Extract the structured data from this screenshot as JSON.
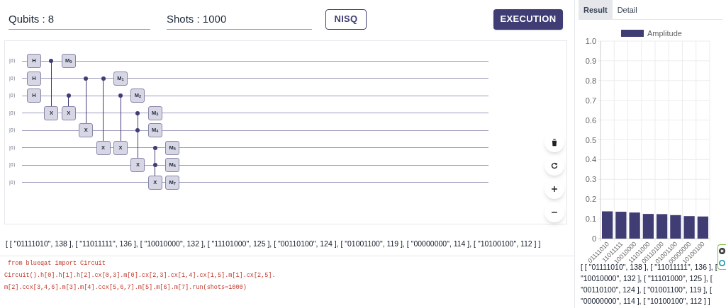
{
  "fields": [
    {
      "value": "Qubits : 8"
    },
    {
      "value": "Shots : 1000"
    }
  ],
  "nisq_button": "NISQ",
  "execution_button": "EXECUTION",
  "circuit": {
    "wires": [
      "|0⟩",
      "|0⟩",
      "|0⟩",
      "|0⟩",
      "|0⟩",
      "|0⟩",
      "|0⟩",
      "|0⟩"
    ],
    "steps": [
      [
        {
          "kind": "gate",
          "label": "H"
        },
        {
          "kind": "gate",
          "label": "H"
        },
        {
          "kind": "gate",
          "label": "H"
        },
        {
          "kind": "idle"
        },
        {
          "kind": "idle"
        },
        {
          "kind": "idle"
        },
        {
          "kind": "idle"
        },
        {
          "kind": "idle"
        }
      ],
      [
        {
          "kind": "control"
        },
        {
          "kind": "idle"
        },
        {
          "kind": "idle"
        },
        {
          "kind": "target",
          "label": "X"
        },
        {
          "kind": "idle"
        },
        {
          "kind": "idle"
        },
        {
          "kind": "idle"
        },
        {
          "kind": "idle"
        }
      ],
      [
        {
          "kind": "gate",
          "label": "M$_{0}$"
        },
        {
          "kind": "idle"
        },
        {
          "kind": "control"
        },
        {
          "kind": "target",
          "label": "X"
        },
        {
          "kind": "idle"
        },
        {
          "kind": "idle"
        },
        {
          "kind": "idle"
        },
        {
          "kind": "idle"
        }
      ],
      [
        {
          "kind": "idle"
        },
        {
          "kind": "control"
        },
        {
          "kind": "idle"
        },
        {
          "kind": "idle"
        },
        {
          "kind": "target",
          "label": "X"
        },
        {
          "kind": "idle"
        },
        {
          "kind": "idle"
        },
        {
          "kind": "idle"
        }
      ],
      [
        {
          "kind": "idle"
        },
        {
          "kind": "control"
        },
        {
          "kind": "idle"
        },
        {
          "kind": "idle"
        },
        {
          "kind": "idle"
        },
        {
          "kind": "target",
          "label": "X"
        },
        {
          "kind": "idle"
        },
        {
          "kind": "idle"
        }
      ],
      [
        {
          "kind": "idle"
        },
        {
          "kind": "gate",
          "label": "M$_{1}$"
        },
        {
          "kind": "control"
        },
        {
          "kind": "idle"
        },
        {
          "kind": "idle"
        },
        {
          "kind": "target",
          "label": "X"
        },
        {
          "kind": "idle"
        },
        {
          "kind": "idle"
        }
      ],
      [
        {
          "kind": "idle"
        },
        {
          "kind": "idle"
        },
        {
          "kind": "gate",
          "label": "M$_{2}$"
        },
        {
          "kind": "control"
        },
        {
          "kind": "control"
        },
        {
          "kind": "idle"
        },
        {
          "kind": "target",
          "label": "X"
        },
        {
          "kind": "idle"
        }
      ],
      [
        {
          "kind": "idle"
        },
        {
          "kind": "idle"
        },
        {
          "kind": "idle"
        },
        {
          "kind": "gate",
          "label": "M$_{3}$"
        },
        {
          "kind": "gate",
          "label": "M$_{4}$"
        },
        {
          "kind": "control"
        },
        {
          "kind": "control"
        },
        {
          "kind": "target",
          "label": "X"
        }
      ],
      [
        {
          "kind": "idle"
        },
        {
          "kind": "idle"
        },
        {
          "kind": "idle"
        },
        {
          "kind": "idle"
        },
        {
          "kind": "idle"
        },
        {
          "kind": "gate",
          "label": "M$_{5}$"
        },
        {
          "kind": "gate",
          "label": "M$_{6}$"
        },
        {
          "kind": "gate",
          "label": "M$_{7}$"
        }
      ]
    ]
  },
  "tool_buttons": [
    {
      "kind": "delete"
    },
    {
      "kind": "reset"
    },
    {
      "kind": "zoom-in"
    },
    {
      "kind": "zoom-out"
    }
  ],
  "result_text": "[ [ \"01111010\", 138 ], [ \"11011111\", 136 ], [ \"10010000\", 132 ], [ \"11101000\", 125 ], [ \"00110100\", 124 ], [ \"01001100\", 119 ], [ \"00000000\", 114 ], [ \"10100100\", 112 ] ]",
  "code_lines": [
    " from blueqat import Circuit",
    "Circuit().h[0].h[1].h[2].cx[0,3].m[0].cx[2,3].cx[1,4].cx[1,5].m[1].cx[2,5].",
    "m[2].ccx[3,4,6].m[3].m[4].ccx[5,6,7].m[5].m[6].m[7].run(shots=1000)"
  ],
  "tabs": [
    {
      "label": "Result",
      "selected": true
    },
    {
      "label": "Detail",
      "selected": false
    }
  ],
  "chart_data": {
    "type": "bar",
    "grid": true,
    "categories": [
      "01111010",
      "11011111",
      "10010000",
      "11101000",
      "00110100",
      "01001100",
      "00000000",
      "10100100"
    ],
    "series": [
      {
        "name": "Amplitude",
        "color": "#3f3d74",
        "values": [
          0.138,
          0.136,
          0.132,
          0.125,
          0.124,
          0.119,
          0.114,
          0.112
        ]
      }
    ],
    "ylim": [
      0,
      1
    ],
    "yticks": [
      {
        "value": 0,
        "label": "0"
      },
      {
        "value": 0.1,
        "label": "0.1"
      },
      {
        "value": 0.2,
        "label": "0.2"
      },
      {
        "value": 0.3,
        "label": "0.3"
      },
      {
        "value": 0.4,
        "label": "0.4"
      },
      {
        "value": 0.5,
        "label": "0.5"
      },
      {
        "value": 0.6,
        "label": "0.6"
      },
      {
        "value": 0.7,
        "label": "0.7"
      },
      {
        "value": 0.8,
        "label": "0.8"
      },
      {
        "value": 0.9,
        "label": "0.9"
      },
      {
        "value": 1,
        "label": "1.0"
      }
    ]
  },
  "side_result_text": "[ [ \"01111010\", 138 ], [ \"11011111\", 136 ], [ \"10010000\", 132 ], [ \"11101000\", 125 ], [ \"00110100\", 124 ], [ \"01001100\", 119 ], [ \"00000000\", 114 ], [ \"10100100\", 112 ] ]"
}
